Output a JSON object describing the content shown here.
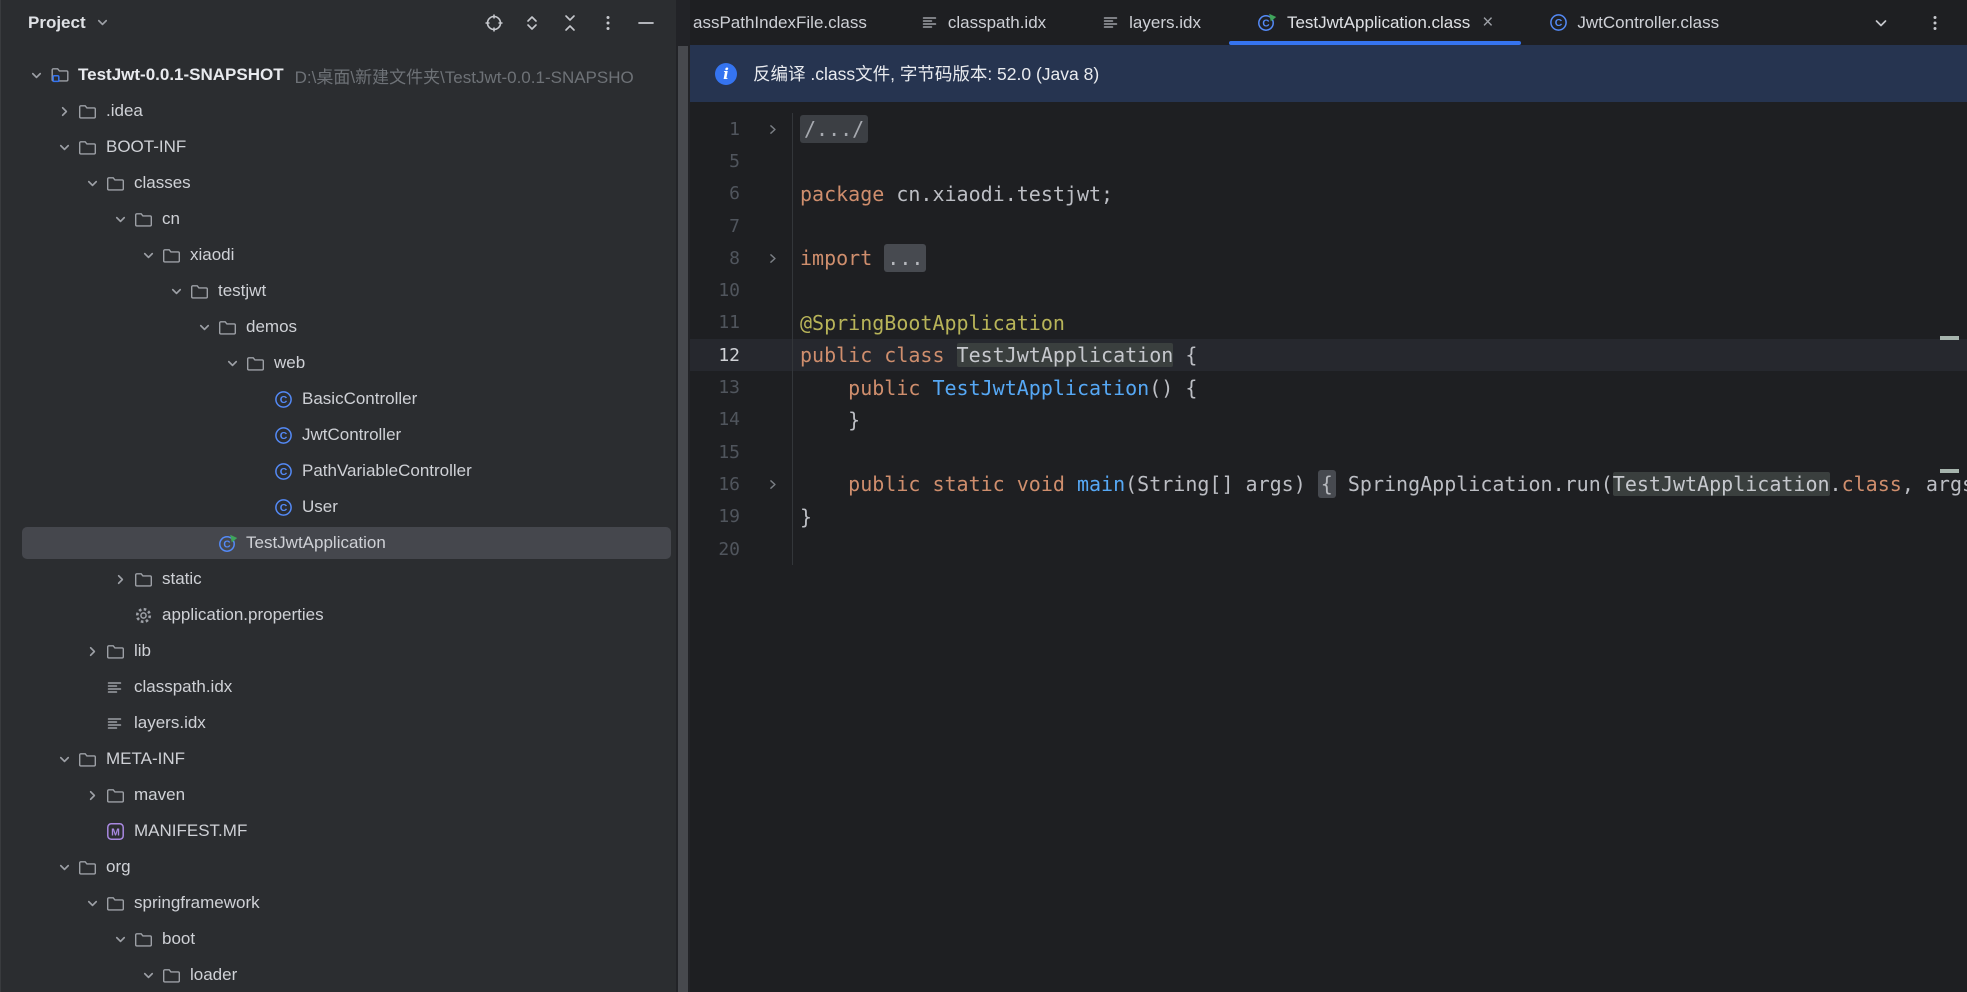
{
  "project_panel": {
    "title": "Project",
    "toolbar_icons": [
      "locate-icon",
      "expand-all-icon",
      "collapse-all-icon",
      "more-options-icon",
      "hide-panel-icon"
    ],
    "tree": [
      {
        "label": "TestJwt-0.0.1-SNAPSHOT",
        "suffix": "D:\\桌面\\新建文件夹\\TestJwt-0.0.1-SNAPSHO",
        "level": 0,
        "chevron": "down",
        "icon": "module",
        "bold": true
      },
      {
        "label": ".idea",
        "level": 1,
        "chevron": "right",
        "icon": "folder"
      },
      {
        "label": "BOOT-INF",
        "level": 1,
        "chevron": "down",
        "icon": "folder"
      },
      {
        "label": "classes",
        "level": 2,
        "chevron": "down",
        "icon": "folder"
      },
      {
        "label": "cn",
        "level": 3,
        "chevron": "down",
        "icon": "folder"
      },
      {
        "label": "xiaodi",
        "level": 4,
        "chevron": "down",
        "icon": "folder"
      },
      {
        "label": "testjwt",
        "level": 5,
        "chevron": "down",
        "icon": "folder"
      },
      {
        "label": "demos",
        "level": 6,
        "chevron": "down",
        "icon": "folder"
      },
      {
        "label": "web",
        "level": 7,
        "chevron": "down",
        "icon": "folder"
      },
      {
        "label": "BasicController",
        "level": 8,
        "icon": "class"
      },
      {
        "label": "JwtController",
        "level": 8,
        "icon": "class"
      },
      {
        "label": "PathVariableController",
        "level": 8,
        "icon": "class"
      },
      {
        "label": "User",
        "level": 8,
        "icon": "class"
      },
      {
        "label": "TestJwtApplication",
        "level": 6,
        "icon": "springclass",
        "selected": true
      },
      {
        "label": "static",
        "level": 3,
        "chevron": "right",
        "icon": "folder"
      },
      {
        "label": "application.properties",
        "level": 3,
        "icon": "gear"
      },
      {
        "label": "lib",
        "level": 2,
        "chevron": "right",
        "icon": "folder"
      },
      {
        "label": "classpath.idx",
        "level": 2,
        "icon": "list"
      },
      {
        "label": "layers.idx",
        "level": 2,
        "icon": "list"
      },
      {
        "label": "META-INF",
        "level": 1,
        "chevron": "down",
        "icon": "folder"
      },
      {
        "label": "maven",
        "level": 2,
        "chevron": "right",
        "icon": "folder"
      },
      {
        "label": "MANIFEST.MF",
        "level": 2,
        "icon": "manifest"
      },
      {
        "label": "org",
        "level": 1,
        "chevron": "down",
        "icon": "folder"
      },
      {
        "label": "springframework",
        "level": 2,
        "chevron": "down",
        "icon": "folder"
      },
      {
        "label": "boot",
        "level": 3,
        "chevron": "down",
        "icon": "folder"
      },
      {
        "label": "loader",
        "level": 4,
        "chevron": "down",
        "icon": "folder"
      }
    ]
  },
  "editor": {
    "tabs": [
      {
        "label": "assPathIndexFile.class",
        "icon": null,
        "active": false,
        "close": false
      },
      {
        "label": "classpath.idx",
        "icon": "list",
        "active": false,
        "close": false
      },
      {
        "label": "layers.idx",
        "icon": "list",
        "active": false,
        "close": false
      },
      {
        "label": "TestJwtApplication.class",
        "icon": "springclass",
        "active": true,
        "close": true
      },
      {
        "label": "JwtController.class",
        "icon": "class",
        "active": false,
        "close": false
      }
    ],
    "tab_controls": [
      "chevron-down-icon",
      "more-options-icon"
    ],
    "banner": {
      "text": "反编译 .class文件, 字节码版本: 52.0 (Java 8)"
    },
    "code_lines": [
      {
        "num": "1",
        "fold": true,
        "seg": [
          [
            "cfold",
            "/.../"
          ]
        ]
      },
      {
        "num": "5",
        "seg": []
      },
      {
        "num": "6",
        "seg": [
          [
            "kw",
            "package"
          ],
          [
            "pl",
            " cn.xiaodi.testjwt;"
          ]
        ]
      },
      {
        "num": "7",
        "seg": []
      },
      {
        "num": "8",
        "fold": true,
        "seg": [
          [
            "kw",
            "import"
          ],
          [
            "pl",
            " "
          ],
          [
            "fold",
            "..."
          ]
        ]
      },
      {
        "num": "10",
        "seg": []
      },
      {
        "num": "11",
        "seg": [
          [
            "ann",
            "@SpringBootApplication"
          ]
        ]
      },
      {
        "num": "12",
        "current": true,
        "seg": [
          [
            "kw",
            "public class"
          ],
          [
            "pl",
            " "
          ],
          [
            "hl",
            "TestJwtApplication"
          ],
          [
            "pl",
            " {"
          ]
        ]
      },
      {
        "num": "13",
        "seg": [
          [
            "pl",
            "    "
          ],
          [
            "kw",
            "public"
          ],
          [
            "pl",
            " "
          ],
          [
            "ctor",
            "TestJwtApplication"
          ],
          [
            "pl",
            "() {"
          ]
        ]
      },
      {
        "num": "14",
        "seg": [
          [
            "pl",
            "    }"
          ]
        ]
      },
      {
        "num": "15",
        "seg": []
      },
      {
        "num": "16",
        "fold": true,
        "seg": [
          [
            "pl",
            "    "
          ],
          [
            "kw",
            "public static void"
          ],
          [
            "pl",
            " "
          ],
          [
            "ctor",
            "main"
          ],
          [
            "pl",
            "(String[] args) "
          ],
          [
            "fold",
            "{"
          ],
          [
            "pl",
            " SpringApplication.run("
          ],
          [
            "hl",
            "TestJwtApplication"
          ],
          [
            "pl",
            "."
          ],
          [
            "kw",
            "class"
          ],
          [
            "pl",
            ", args"
          ]
        ]
      },
      {
        "num": "19",
        "seg": [
          [
            "pl",
            "}"
          ]
        ]
      },
      {
        "num": "20",
        "seg": []
      }
    ]
  },
  "colors": {
    "accent_blue": "#3574F0",
    "banner_bg": "#263450",
    "panel_bg": "#2B2D30",
    "editor_bg": "#1E1F22",
    "selection_row": "#45474D",
    "current_line": "#26282E",
    "keyword_orange": "#CF8E6D",
    "annotation_yellow": "#B8B459",
    "method_blue": "#56A8F5",
    "class_icon_blue": "#548AF7",
    "run_triangle_green": "#3FA45B",
    "manifest_purple": "#A888E0",
    "stripe_mark": "#A6B4AD"
  }
}
